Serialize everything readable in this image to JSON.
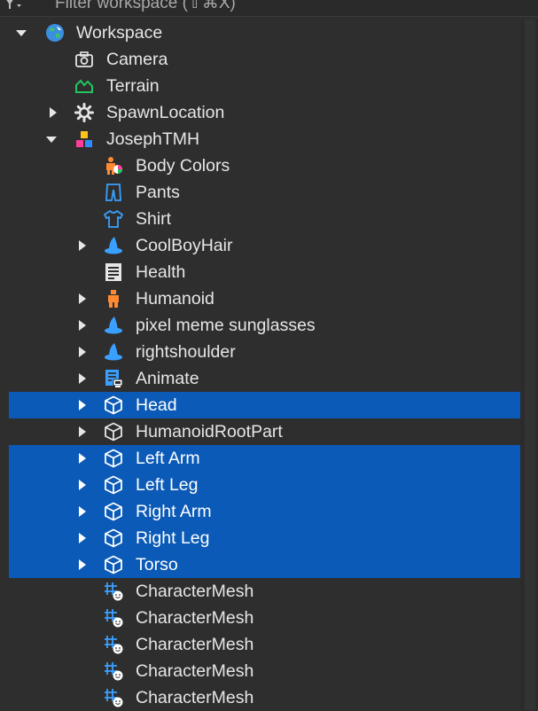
{
  "filter": {
    "placeholder": "Filter workspace (⇧⌘X)"
  },
  "colors": {
    "selection": "#0b5ab7",
    "panel": "#2e2e2e",
    "part_icon": "#e6e6e6",
    "blue_icon": "#3aa0ff",
    "orange_icon": "#ff8a33",
    "terrain_icon": "#22c55e"
  },
  "tree": {
    "items": [
      {
        "label": "Workspace",
        "icon": "workspace-globe-icon",
        "expanded": true,
        "selected": false
      },
      {
        "label": "Camera",
        "icon": "camera-icon",
        "selected": false
      },
      {
        "label": "Terrain",
        "icon": "terrain-icon",
        "selected": false
      },
      {
        "label": "SpawnLocation",
        "icon": "spawn-location-icon",
        "expanded": false,
        "selected": false
      },
      {
        "label": "JosephTMH",
        "icon": "model-icon",
        "expanded": true,
        "selected": false
      },
      {
        "label": "Body Colors",
        "icon": "body-colors-icon",
        "selected": false
      },
      {
        "label": "Pants",
        "icon": "pants-icon",
        "selected": false
      },
      {
        "label": "Shirt",
        "icon": "shirt-icon",
        "selected": false
      },
      {
        "label": "CoolBoyHair",
        "icon": "accessory-hat-icon",
        "expanded": false,
        "selected": false
      },
      {
        "label": "Health",
        "icon": "script-icon",
        "selected": false
      },
      {
        "label": "Humanoid",
        "icon": "humanoid-icon",
        "expanded": false,
        "selected": false
      },
      {
        "label": "pixel meme sunglasses",
        "icon": "accessory-hat-icon",
        "expanded": false,
        "selected": false
      },
      {
        "label": "rightshoulder",
        "icon": "accessory-hat-icon",
        "expanded": false,
        "selected": false
      },
      {
        "label": "Animate",
        "icon": "local-script-icon",
        "expanded": false,
        "selected": false
      },
      {
        "label": "Head",
        "icon": "part-cube-icon",
        "expanded": false,
        "selected": true
      },
      {
        "label": "HumanoidRootPart",
        "icon": "part-cube-icon",
        "expanded": false,
        "selected": false
      },
      {
        "label": "Left Arm",
        "icon": "part-cube-icon",
        "expanded": false,
        "selected": true
      },
      {
        "label": "Left Leg",
        "icon": "part-cube-icon",
        "expanded": false,
        "selected": true
      },
      {
        "label": "Right Arm",
        "icon": "part-cube-icon",
        "expanded": false,
        "selected": true
      },
      {
        "label": "Right Leg",
        "icon": "part-cube-icon",
        "expanded": false,
        "selected": true
      },
      {
        "label": "Torso",
        "icon": "part-cube-icon",
        "expanded": false,
        "selected": true
      },
      {
        "label": "CharacterMesh",
        "icon": "character-mesh-icon",
        "selected": false
      },
      {
        "label": "CharacterMesh",
        "icon": "character-mesh-icon",
        "selected": false
      },
      {
        "label": "CharacterMesh",
        "icon": "character-mesh-icon",
        "selected": false
      },
      {
        "label": "CharacterMesh",
        "icon": "character-mesh-icon",
        "selected": false
      },
      {
        "label": "CharacterMesh",
        "icon": "character-mesh-icon",
        "selected": false
      }
    ]
  }
}
